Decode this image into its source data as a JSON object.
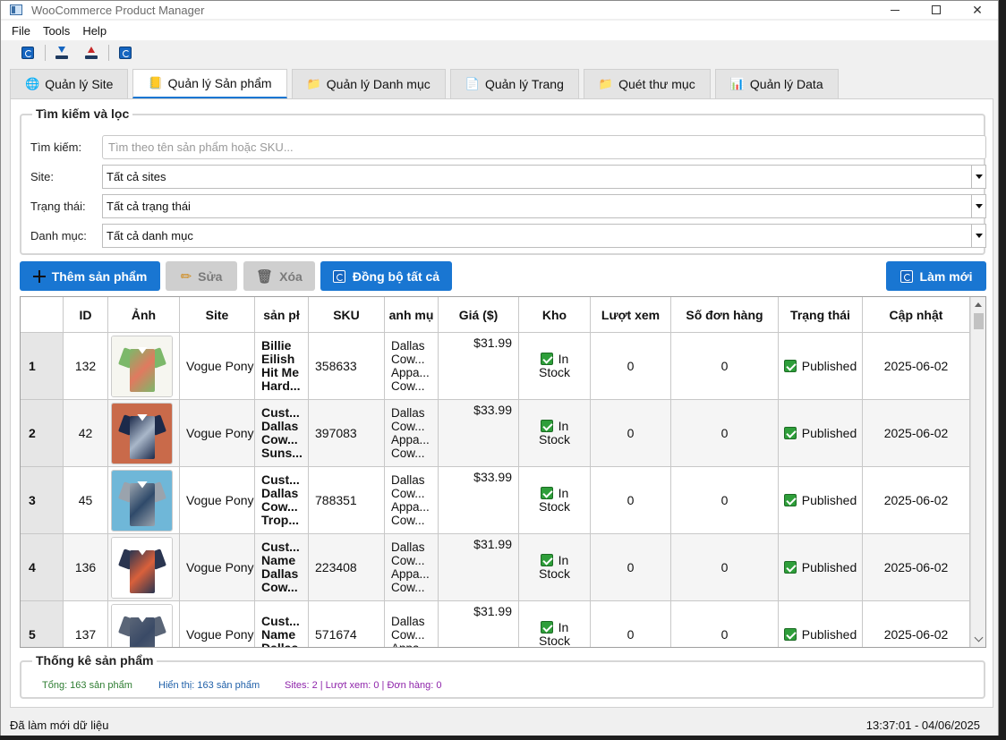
{
  "app": {
    "title": "WooCommerce Product Manager"
  },
  "menu": [
    "File",
    "Tools",
    "Help"
  ],
  "toolbar": {
    "icons": [
      "refresh-icon",
      "download-icon",
      "upload-icon",
      "refresh-icon"
    ]
  },
  "tabs": [
    {
      "label": "Quản lý Site",
      "icon": "globe-icon"
    },
    {
      "label": "Quản lý Sản phẩm",
      "icon": "book-icon",
      "active": true
    },
    {
      "label": "Quản lý Danh mục",
      "icon": "folder-icon"
    },
    {
      "label": "Quản lý Trang",
      "icon": "page-icon"
    },
    {
      "label": "Quét thư mục",
      "icon": "folder-icon"
    },
    {
      "label": "Quản lý Data",
      "icon": "chart-icon"
    }
  ],
  "filters": {
    "title": "Tìm kiếm và lọc",
    "search_label": "Tìm kiếm:",
    "search_placeholder": "Tìm theo tên sản phẩm hoặc SKU...",
    "site_label": "Site:",
    "site_value": "Tất cả sites",
    "status_label": "Trạng thái:",
    "status_value": "Tất cả trạng thái",
    "category_label": "Danh mục:",
    "category_value": "Tất cả danh mục"
  },
  "actions": {
    "add": "Thêm sản phẩm",
    "edit": "Sửa",
    "delete": "Xóa",
    "sync_all": "Đồng bộ tất cả",
    "refresh": "Làm mới"
  },
  "table": {
    "columns": [
      "ID",
      "Ảnh",
      "Site",
      "sản pł",
      "SKU",
      "anh mụ",
      "Giá ($)",
      "Kho",
      "Lượt xem",
      "Số đơn hàng",
      "Trạng thái",
      "Cập nhật"
    ],
    "rows": [
      {
        "row": "1",
        "id": "132",
        "site": "Vogue Pony",
        "name": [
          "Billie",
          "Eilish",
          "Hit Me",
          "Hard..."
        ],
        "sku": "358633",
        "category": [
          "Dallas",
          "Cow...",
          "Appa...",
          "Cow..."
        ],
        "price": "$31.99",
        "stock": "In Stock",
        "views": "0",
        "orders": "0",
        "status": "Published",
        "updated": "2025-06-02",
        "thumb_colors": [
          "#f6f6f0",
          "#7cb86a",
          "#e07a5f"
        ]
      },
      {
        "row": "2",
        "id": "42",
        "site": "Vogue Pony",
        "name": [
          "Cust...",
          "Dallas",
          "Cow...",
          "Suns..."
        ],
        "sku": "397083",
        "category": [
          "Dallas",
          "Cow...",
          "Appa...",
          "Cow..."
        ],
        "price": "$33.99",
        "stock": "In Stock",
        "views": "0",
        "orders": "0",
        "status": "Published",
        "updated": "2025-06-02",
        "thumb_colors": [
          "#c96a4a",
          "#1c2a4a",
          "#a9b7c9"
        ]
      },
      {
        "row": "3",
        "id": "45",
        "site": "Vogue Pony",
        "name": [
          "Cust...",
          "Dallas",
          "Cow...",
          "Trop..."
        ],
        "sku": "788351",
        "category": [
          "Dallas",
          "Cow...",
          "Appa...",
          "Cow..."
        ],
        "price": "$33.99",
        "stock": "In Stock",
        "views": "0",
        "orders": "0",
        "status": "Published",
        "updated": "2025-06-02",
        "thumb_colors": [
          "#6fb7d8",
          "#9aa3ad",
          "#2f4a6a"
        ]
      },
      {
        "row": "4",
        "id": "136",
        "site": "Vogue Pony",
        "name": [
          "Cust...",
          "Name",
          "Dallas",
          "Cow..."
        ],
        "sku": "223408",
        "category": [
          "Dallas",
          "Cow...",
          "Appa...",
          "Cow..."
        ],
        "price": "$31.99",
        "stock": "In Stock",
        "views": "0",
        "orders": "0",
        "status": "Published",
        "updated": "2025-06-02",
        "thumb_colors": [
          "#ffffff",
          "#2a3550",
          "#d9603b"
        ]
      },
      {
        "row": "5",
        "id": "137",
        "site": "Vogue Pony",
        "name": [
          "Cust...",
          "Name",
          "Dallas"
        ],
        "sku": "571674",
        "category": [
          "Dallas",
          "Cow...",
          "Appa..."
        ],
        "price": "$31.99",
        "stock": "In Stock",
        "views": "0",
        "orders": "0",
        "status": "Published",
        "updated": "2025-06-02",
        "thumb_colors": [
          "#ffffff",
          "#5a6577",
          "#3a4a66"
        ]
      }
    ]
  },
  "stats": {
    "title": "Thống kê sản phẩm",
    "total": "Tổng: 163 sản phẩm",
    "shown": "Hiển thị: 163 sản phẩm",
    "summary": "Sites: 2 | Lượt xem: 0 | Đơn hàng: 0",
    "colors": {
      "total": "#2e7d32",
      "shown": "#1e5fa8",
      "summary": "#8e24aa"
    }
  },
  "status_bar": {
    "message": "Đã làm mới dữ liệu",
    "datetime": "13:37:01 - 04/06/2025"
  },
  "colors": {
    "accent": "#1976d2",
    "disabled": "#cfcfcf",
    "check": "#2e9e3a"
  }
}
